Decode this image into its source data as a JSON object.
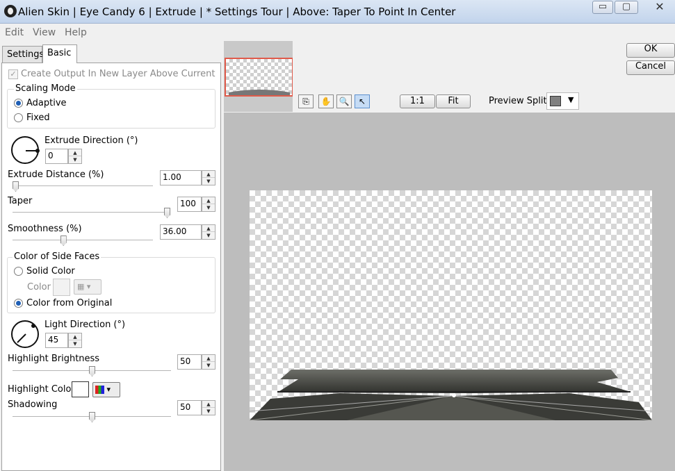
{
  "window": {
    "title": "Alien Skin | Eye Candy 6 | Extrude | * Settings Tour | Above: Taper To Point In Center",
    "controls": {
      "minimize": "▭",
      "maximize": "▢",
      "close": "✕"
    }
  },
  "menu": {
    "items": [
      "Edit",
      "View",
      "Help"
    ]
  },
  "tabs": [
    "Settings",
    "Basic"
  ],
  "basic": {
    "create_output_label": "Create Output In New Layer Above Current",
    "scaling_mode": {
      "label": "Scaling Mode",
      "options": [
        "Adaptive",
        "Fixed"
      ],
      "selected": "Adaptive"
    },
    "extrude_direction": {
      "label": "Extrude Direction (°)",
      "value": "0"
    },
    "extrude_distance": {
      "label": "Extrude Distance (%)",
      "value": "1.00",
      "slider_level": 0.02
    },
    "taper": {
      "label": "Taper",
      "value": "100",
      "slider_level": 1.0
    },
    "smoothness": {
      "label": "Smoothness (%)",
      "value": "36.00",
      "slider_level": 0.36
    },
    "side_faces": {
      "label": "Color of Side Faces",
      "solid_color": "Solid Color",
      "color_label": "Color",
      "from_original": "Color from Original",
      "selected": "Color from Original"
    },
    "light_direction": {
      "label": "Light Direction (°)",
      "value": "45"
    },
    "highlight_brightness": {
      "label": "Highlight Brightness",
      "value": "50",
      "slider_level": 0.5
    },
    "highlight_color": {
      "label": "Highlight Color",
      "color": "#ffffff"
    },
    "shadowing": {
      "label": "Shadowing",
      "value": "50",
      "slider_level": 0.5
    }
  },
  "preview": {
    "ok": "OK",
    "cancel": "Cancel",
    "zoom_1_1": "1:1",
    "fit": "Fit",
    "split_label": "Preview Split",
    "split_color": "#808080",
    "tools": [
      "copy-icon",
      "hand-icon",
      "zoom-icon",
      "pointer-icon"
    ]
  }
}
